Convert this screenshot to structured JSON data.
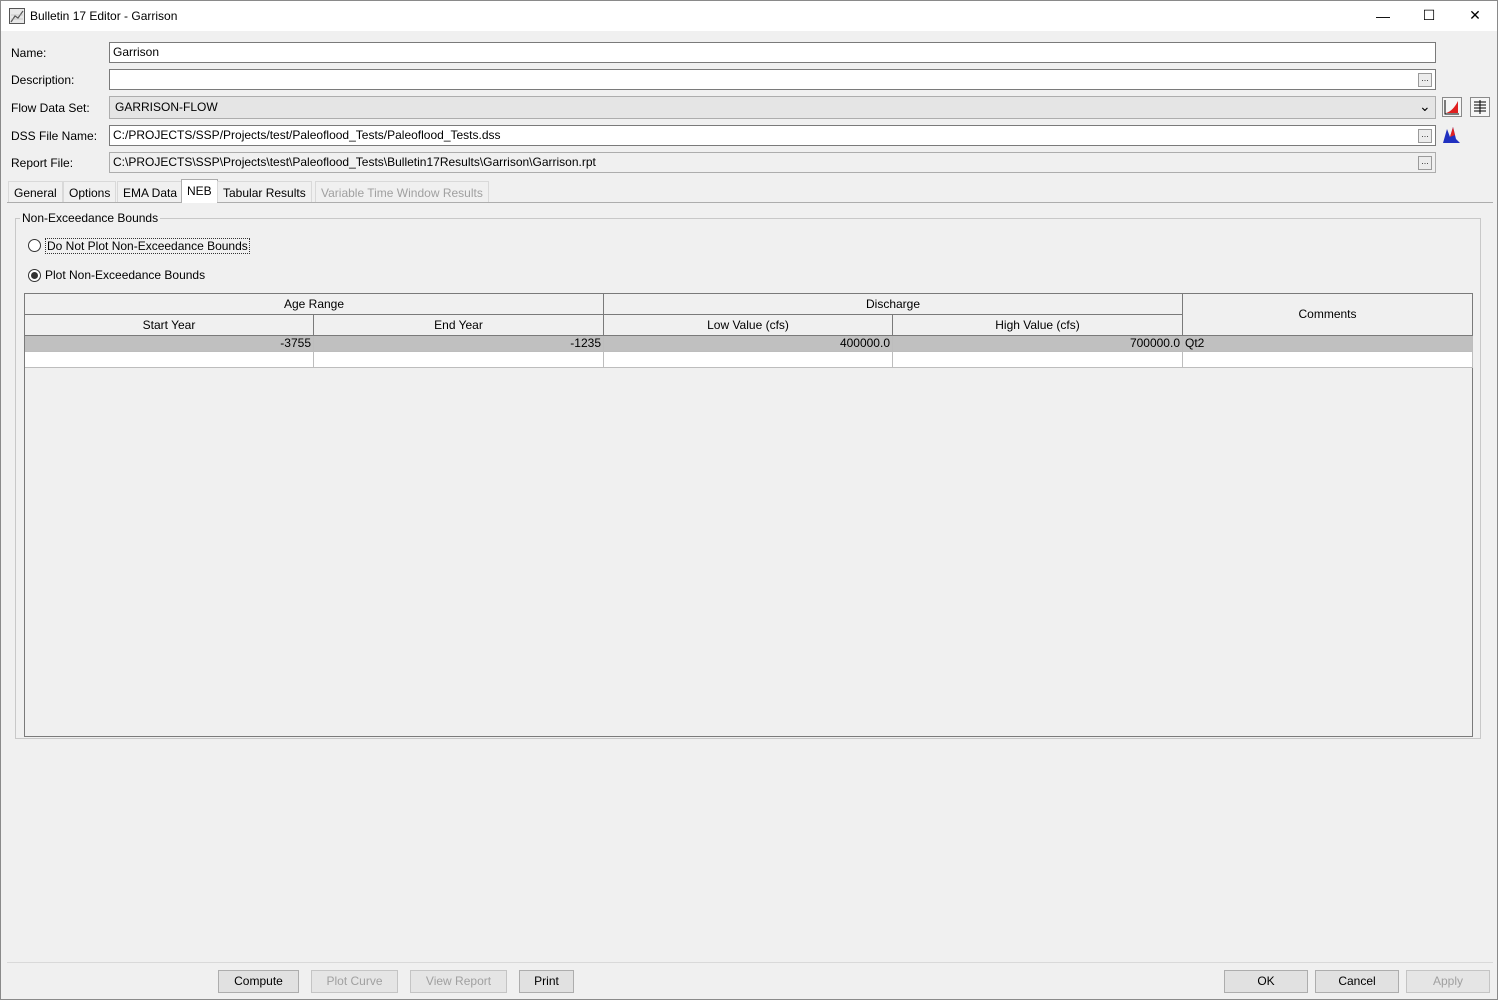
{
  "window": {
    "title": "Bulletin 17 Editor - Garrison",
    "minimize_glyph": "—",
    "maximize_glyph": "☐",
    "close_glyph": "✕"
  },
  "form": {
    "name_label": "Name:",
    "name_value": "Garrison",
    "description_label": "Description:",
    "description_value": "",
    "flow_label": "Flow Data Set:",
    "flow_value": "GARRISON-FLOW",
    "dss_label": "DSS File Name:",
    "dss_value": "C:/PROJECTS/SSP/Projects/test/Paleoflood_Tests/Paleoflood_Tests.dss",
    "report_label": "Report File:",
    "report_value": "C:\\PROJECTS\\SSP\\Projects\\test\\Paleoflood_Tests\\Bulletin17Results\\Garrison\\Garrison.rpt",
    "browse_glyph": "...",
    "dropdown_glyph": "⌄"
  },
  "tabs": [
    {
      "label": "General"
    },
    {
      "label": "Options"
    },
    {
      "label": "EMA Data"
    },
    {
      "label": "NEB",
      "active": true
    },
    {
      "label": "Tabular Results"
    },
    {
      "label": "Variable Time Window Results",
      "disabled": true
    }
  ],
  "neb": {
    "group_title": "Non-Exceedance Bounds",
    "option_no_plot": "Do Not Plot Non-Exceedance Bounds",
    "option_plot": "Plot Non-Exceedance Bounds",
    "selected": "plot"
  },
  "table": {
    "group_headers": [
      "Age Range",
      "Discharge"
    ],
    "columns": [
      "Start Year",
      "End Year",
      "Low Value (cfs)",
      "High Value (cfs)",
      "Comments"
    ],
    "rows": [
      {
        "start_year": "-3755",
        "end_year": "-1235",
        "low": "400000.0",
        "high": "700000.0",
        "comments": "Qt2"
      }
    ]
  },
  "buttons": {
    "compute": "Compute",
    "plot_curve": "Plot Curve",
    "view_report": "View Report",
    "print": "Print",
    "ok": "OK",
    "cancel": "Cancel",
    "apply": "Apply"
  },
  "colors": {
    "selected_row": "#c0c0c0",
    "plot_icon_red": "#e02020",
    "plot_icon_blue": "#2030c0"
  }
}
